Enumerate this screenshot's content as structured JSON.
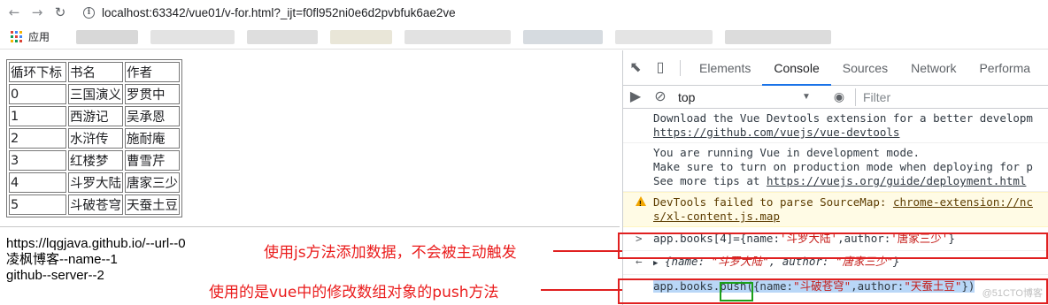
{
  "browser": {
    "url_host": "localhost:63342/vue01/v-for.html?_ijt=f0fl952ni0e6d2pvbfuk6ae2ve",
    "bookmarks": {
      "apps_label": "应用"
    }
  },
  "table": {
    "headers": [
      "循环下标",
      "书名",
      "作者"
    ],
    "rows": [
      [
        "0",
        "三国演义",
        "罗贯中"
      ],
      [
        "1",
        "西游记",
        "吴承恩"
      ],
      [
        "2",
        "水浒传",
        "施耐庵"
      ],
      [
        "3",
        "红楼梦",
        "曹雪芹"
      ],
      [
        "4",
        "斗罗大陆",
        "唐家三少"
      ],
      [
        "5",
        "斗破苍穹",
        "天蚕土豆"
      ]
    ]
  },
  "links": [
    "https://lqgjava.github.io/--url--0",
    "凌枫博客--name--1",
    "github--server--2"
  ],
  "annotations": {
    "first": "使用js方法添加数据，不会被主动触发",
    "second": "使用的是vue中的修改数组对象的push方法"
  },
  "devtools": {
    "tabs": [
      "Elements",
      "Console",
      "Sources",
      "Network",
      "Performa"
    ],
    "context": "top",
    "filter_placeholder": "Filter",
    "messages": {
      "m1_line1": "Download the Vue Devtools extension for a better developm",
      "m1_link": "https://github.com/vuejs/vue-devtools",
      "m2_line1": "You are running Vue in development mode.",
      "m2_line2": "Make sure to turn on production mode when deploying for p",
      "m2_line3_pre": "See more tips at ",
      "m2_line3_link": "https://vuejs.org/guide/deployment.html",
      "warn_pre": "DevTools failed to parse SourceMap: ",
      "warn_link1": "chrome-extension://nc",
      "warn_link2": "s/xl-content.js.map",
      "cmd1_pre": "app.books[4]={name:",
      "cmd1_s1": "'斗罗大陆'",
      "cmd1_mid": ",author:",
      "cmd1_s2": "'唐家三少'",
      "cmd1_end": "}",
      "res1_pre": "{name: ",
      "res1_s1": "\"斗罗大陆\"",
      "res1_mid": ", author: ",
      "res1_s2": "\"唐家三少\"",
      "res1_end": "}",
      "cmd2_pre": "app.books.",
      "cmd2_push": "push",
      "cmd2_open": "({name:",
      "cmd2_s1": "\"斗破苍穹\"",
      "cmd2_mid": ",author:",
      "cmd2_s2": "\"天蚕土豆\"",
      "cmd2_end": "})"
    },
    "watermark": "@51CTO博客"
  }
}
